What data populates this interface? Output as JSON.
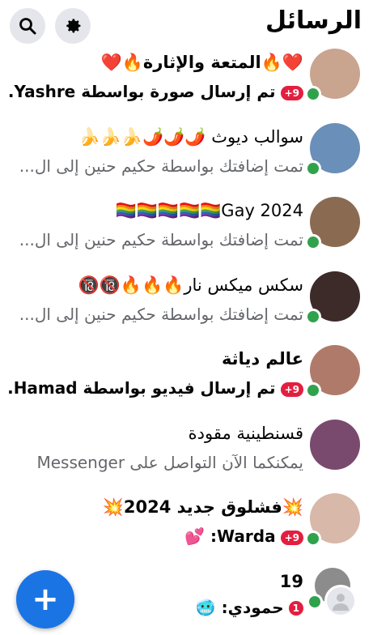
{
  "header": {
    "title": "الرسائل",
    "search_icon": "search-icon",
    "settings_icon": "gear-icon"
  },
  "conversations": [
    {
      "name": "❤️🔥المتعة والإثارة🔥❤️",
      "snippet": "تم إرسال صورة بواسطة Yashre.",
      "badge": "9+",
      "unread": true,
      "online": true,
      "avatar_color": "#c9a48f"
    },
    {
      "name": "سوالب ديوث 🌶️🌶️🌶️🍌🍌🍌",
      "snippet": "تمت إضافتك بواسطة حكيم حنين إلى ال...",
      "badge": "",
      "unread": false,
      "online": true,
      "avatar_color": "#6a8fb8"
    },
    {
      "name": "Gay 2024🏳️‍🌈🏳️‍🌈🏳️‍🌈🏳️‍🌈🏳️‍🌈",
      "snippet": "تمت إضافتك بواسطة حكيم حنين إلى ال...",
      "badge": "",
      "unread": false,
      "online": true,
      "avatar_color": "#8a6b52"
    },
    {
      "name": "سكس ميكس نار🔥🔥🔥🔞🔞",
      "snippet": "تمت إضافتك بواسطة حكيم حنين إلى ال...",
      "badge": "",
      "unread": false,
      "online": true,
      "avatar_color": "#3d2b2a"
    },
    {
      "name": "عالم دياثة",
      "snippet": "تم إرسال فيديو بواسطة Hamad...",
      "badge": "9+",
      "unread": true,
      "online": true,
      "avatar_color": "#b07a6a"
    },
    {
      "name": "قسنطينية مقودة",
      "snippet": "يمكنكما الآن التواصل على Messenger",
      "badge": "",
      "unread": false,
      "online": false,
      "avatar_color": "#7a4a6e"
    },
    {
      "name": "💥فشلوق جديد 2024💥",
      "snippet": "Warda: 💕",
      "badge": "9+",
      "unread": true,
      "online": true,
      "avatar_color": "#d8b8a8"
    },
    {
      "name": "19",
      "snippet": "حمودي: 🥶",
      "badge": "1",
      "unread": true,
      "online": true,
      "avatar_color": "#8c8c8c"
    }
  ],
  "fab": {
    "label": "+",
    "icon": "plus-icon",
    "color": "#1b74e4"
  }
}
